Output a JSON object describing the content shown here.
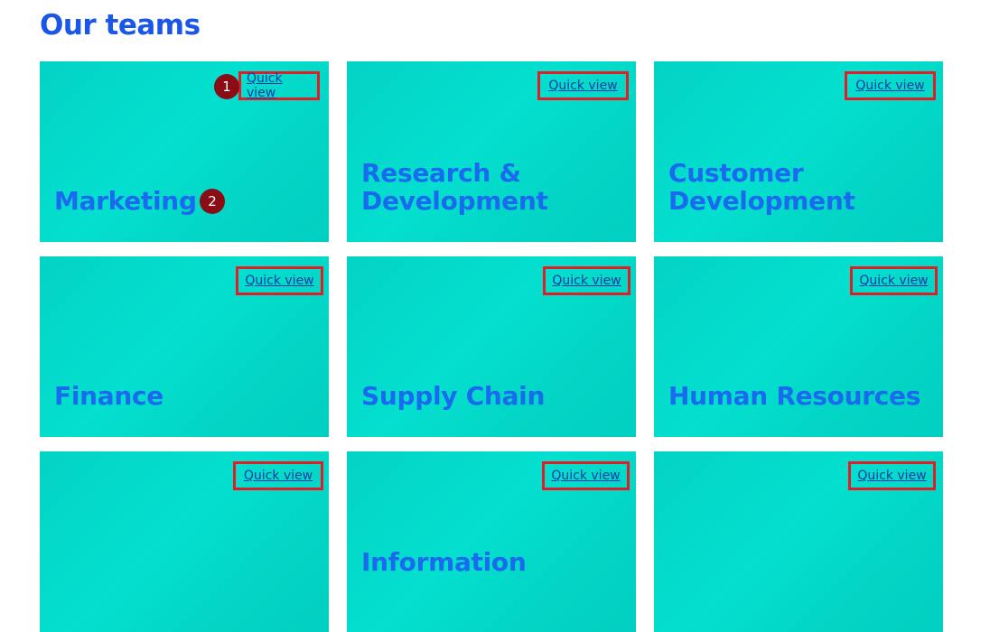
{
  "page": {
    "title": "Our teams"
  },
  "cards": [
    {
      "title": "Marketing",
      "quick_view": "Quick view"
    },
    {
      "title": "Research & Development",
      "quick_view": "Quick view"
    },
    {
      "title": "Customer Development",
      "quick_view": "Quick view"
    },
    {
      "title": "Finance",
      "quick_view": "Quick view"
    },
    {
      "title": "Supply Chain",
      "quick_view": "Quick view"
    },
    {
      "title": "Human Resources",
      "quick_view": "Quick view"
    },
    {
      "title": "",
      "quick_view": "Quick view"
    },
    {
      "title": "Information",
      "quick_view": "Quick view"
    },
    {
      "title": "",
      "quick_view": "Quick view"
    }
  ],
  "badges": {
    "first": "1",
    "second": "2"
  },
  "colors": {
    "title": "#1a56e8",
    "card_bg": "#03d6c8",
    "card_title": "#1a6af0",
    "highlight_border": "#e01e24",
    "badge": "#8a0d16"
  }
}
